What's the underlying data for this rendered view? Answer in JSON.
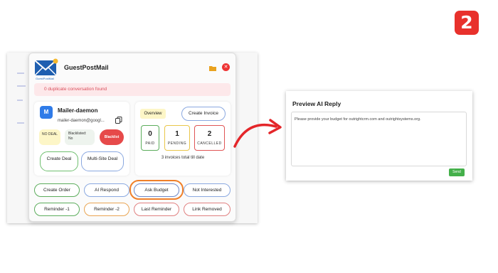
{
  "step_badge": "2",
  "app": {
    "title": "GuestPostMail",
    "logo_tag": "GuestPostMail"
  },
  "alert": {
    "text": "0 duplicate conversation found"
  },
  "contact": {
    "avatar_letter": "M",
    "name": "Mailer-daemon",
    "email": "mailer-daemon@googl...",
    "deal_status": "NO DEAL",
    "blacklisted_label": "Blacklisted:",
    "blacklisted_value": "No",
    "blacklist_button": "Blacklist",
    "create_deal": "Create Deal",
    "multi_site_deal": "Multi-Site Deal"
  },
  "invoices": {
    "overview_label": "Overview",
    "create_invoice": "Create Invoice",
    "paid": {
      "value": "0",
      "label": "PAID"
    },
    "pending": {
      "value": "1",
      "label": "PENDING"
    },
    "cancelled": {
      "value": "2",
      "label": "CANCELLED"
    },
    "summary": "3 invoices total till date"
  },
  "actions": {
    "create_order": "Create Order",
    "ai_respond": "AI Respond",
    "ask_budget": "Ask Budget",
    "not_interested": "Not Interested",
    "reminder_1": "Reminder -1",
    "reminder_2": "Reminder -2",
    "last_reminder": "Last Reminder",
    "link_removed": "Link Removed"
  },
  "preview": {
    "title": "Preview AI Reply",
    "text": "Please provide your budget for outrightcrm.com and outrightsystems.org.",
    "send": "Send"
  },
  "colors": {
    "accent_highlight": "#f0802a",
    "badge": "#e8312c",
    "send": "#44b04a",
    "danger": "#e64a4a"
  }
}
